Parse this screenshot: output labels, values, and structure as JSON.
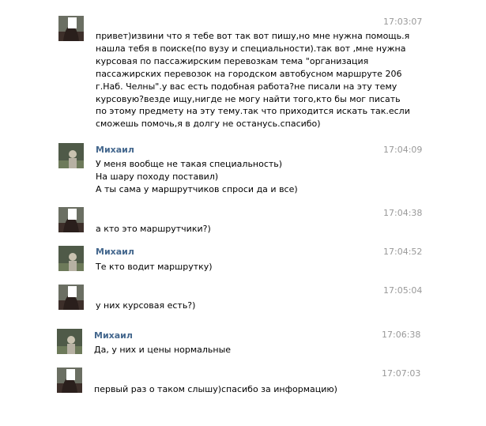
{
  "messages": [
    {
      "author": "",
      "time": "17:03:07",
      "avatar": "female-avatar",
      "lines": [
        "привет)извини что я тебе вот так вот пишу,но мне нужна помощь.я",
        "нашла тебя в поиске(по вузу и специальности).так вот ,мне нужна",
        "курсовая по пассажирским перевозкам тема \"организация",
        "пассажирских перевозок на городском автобусном маршруте 206",
        "г.Наб. Челны\".у вас есть подобная работа?не писали на эту тему",
        "курсовую?везде ищу,нигде не могу найти того,кто бы мог писать",
        "по этому предмету на эту тему.так что приходится искать так.если",
        "сможешь помочь,я в долгу не останусь.спасибо)"
      ]
    },
    {
      "author": "Михаил",
      "time": "17:04:09",
      "avatar": "male-avatar",
      "lines": [
        "У меня вообще не такая специальность)",
        "На шару походу поставил)",
        "А ты сама у маршрутчиков спроси да и все)"
      ]
    },
    {
      "author": "",
      "time": "17:04:38",
      "avatar": "female-avatar",
      "lines": [
        "а кто это маршрутчики?)"
      ]
    },
    {
      "author": "Михаил",
      "time": "17:04:52",
      "avatar": "male-avatar",
      "lines": [
        "Те кто водит маршрутку)"
      ]
    },
    {
      "author": "",
      "time": "17:05:04",
      "avatar": "female-avatar",
      "lines": [
        "у них курсовая есть?)"
      ]
    },
    {
      "author": "Михаил",
      "time": "17:06:38",
      "avatar": "male-avatar",
      "lines": [
        "Да, у них и цены нормальные"
      ]
    },
    {
      "author": "",
      "time": "17:07:03",
      "avatar": "female-avatar",
      "lines": [
        "первый раз о таком слышу)спасибо за информацию)"
      ]
    }
  ],
  "colors": {
    "author": "#45688e",
    "time": "#999999",
    "text": "#000000",
    "background": "#ffffff"
  }
}
